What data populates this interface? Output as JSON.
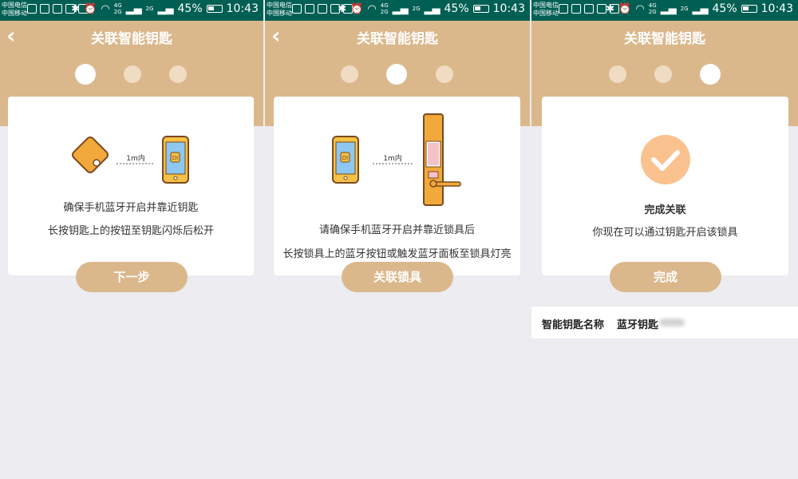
{
  "status_bar": {
    "carrier_line1": "中国电信",
    "carrier_line2": "中国移动",
    "network_line1": "4G",
    "network_line2": "2G",
    "network2": "2G",
    "battery_percent": "45%",
    "time": "10:43"
  },
  "screens": [
    {
      "title": "关联智能钥匙",
      "step_active": 1,
      "distance_label": "1m内",
      "phone_label": "DI",
      "instructions": [
        "确保手机蓝牙开启并靠近钥匙",
        "长按钥匙上的按钮至钥匙闪烁后松开"
      ],
      "button_label": "下一步"
    },
    {
      "title": "关联智能钥匙",
      "step_active": 2,
      "distance_label": "1m内",
      "phone_label": "DI",
      "instructions": [
        "请确保手机蓝牙开启并靠近锁具后",
        "长按锁具上的蓝牙按钮或触发蓝牙面板至锁具灯亮"
      ],
      "button_label": "关联锁具"
    },
    {
      "title": "关联智能钥匙",
      "step_active": 3,
      "success_title": "完成关联",
      "success_message": "你现在可以通过钥匙开启该锁具",
      "button_label": "完成",
      "key_name_label": "智能钥匙名称",
      "key_name_value": "蓝牙钥匙"
    }
  ],
  "colors": {
    "status_bar": "#005f53",
    "header": "#dbb88c",
    "button": "#dbb88c",
    "background": "#ececf1",
    "success": "#f9c28f",
    "key_icon": "#f2a93b"
  },
  "icons": {
    "back": "chevron-left-icon",
    "success": "check-circle-icon"
  }
}
